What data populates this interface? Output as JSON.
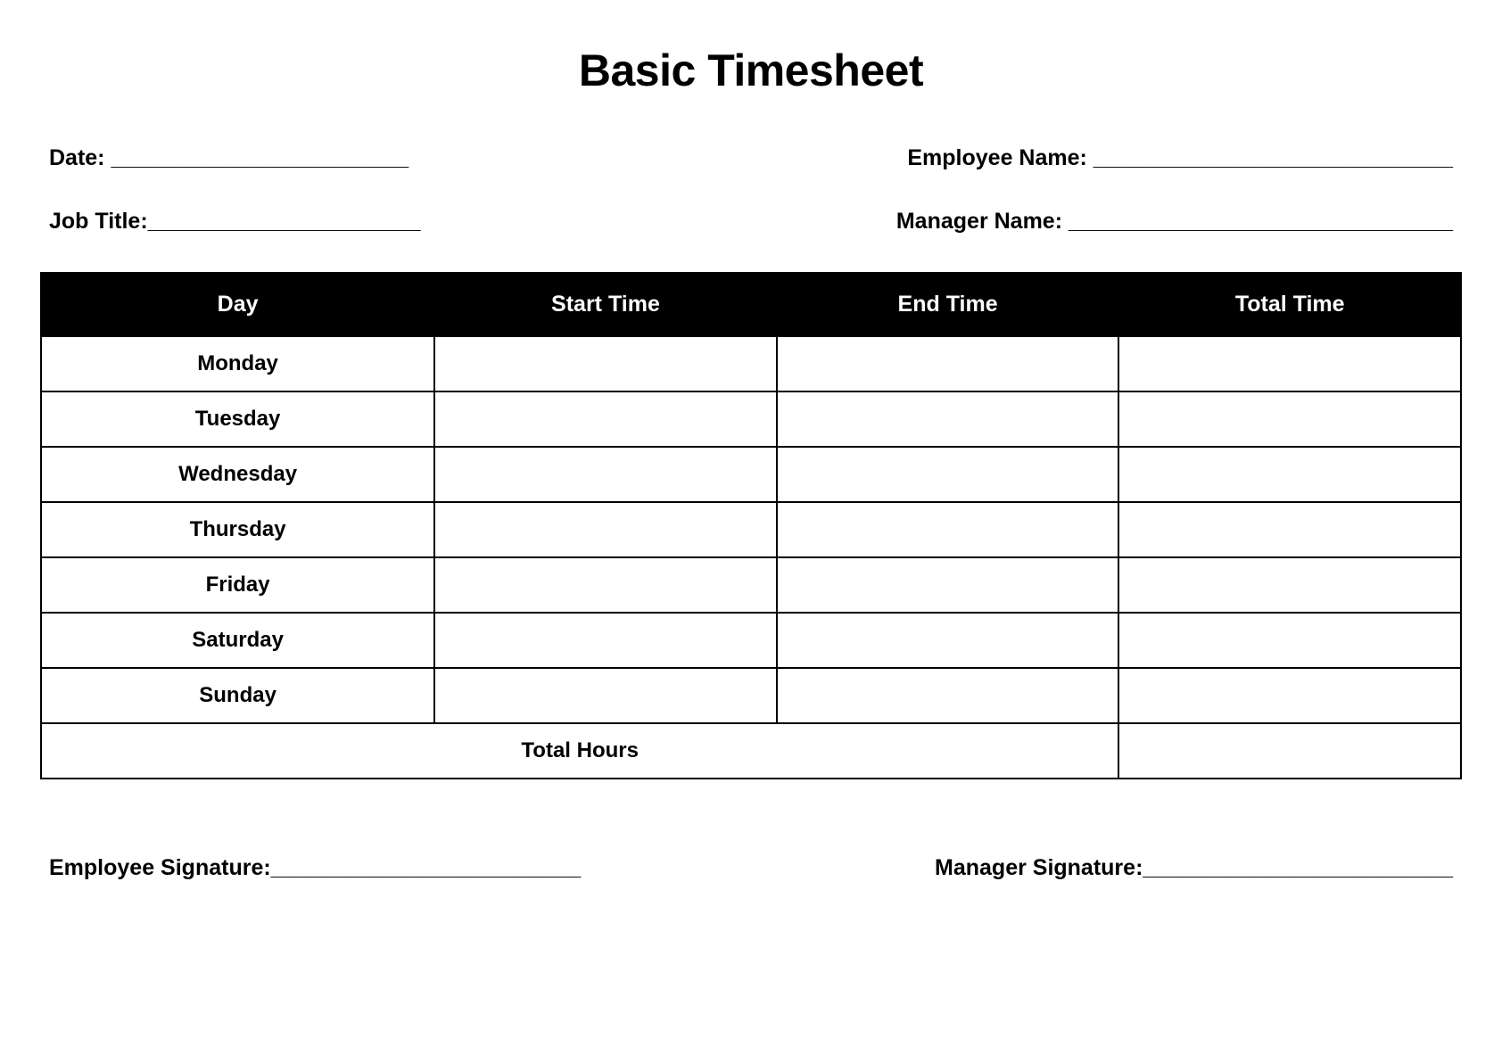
{
  "title": "Basic Timesheet",
  "fields": {
    "date_label": "Date: ________________________",
    "employee_name_label": "Employee Name: _____________________________",
    "job_title_label": "Job Title:______________________",
    "manager_name_label": "Manager Name: _______________________________"
  },
  "table": {
    "headers": {
      "day": "Day",
      "start_time": "Start Time",
      "end_time": "End Time",
      "total_time": "Total Time"
    },
    "rows": [
      {
        "day": "Monday",
        "start": "",
        "end": "",
        "total": ""
      },
      {
        "day": "Tuesday",
        "start": "",
        "end": "",
        "total": ""
      },
      {
        "day": "Wednesday",
        "start": "",
        "end": "",
        "total": ""
      },
      {
        "day": "Thursday",
        "start": "",
        "end": "",
        "total": ""
      },
      {
        "day": "Friday",
        "start": "",
        "end": "",
        "total": ""
      },
      {
        "day": "Saturday",
        "start": "",
        "end": "",
        "total": ""
      },
      {
        "day": "Sunday",
        "start": "",
        "end": "",
        "total": ""
      }
    ],
    "total_hours_label": "Total Hours",
    "total_hours_value": ""
  },
  "signatures": {
    "employee_signature_label": "Employee Signature:_________________________",
    "manager_signature_label": "Manager Signature:_________________________"
  }
}
